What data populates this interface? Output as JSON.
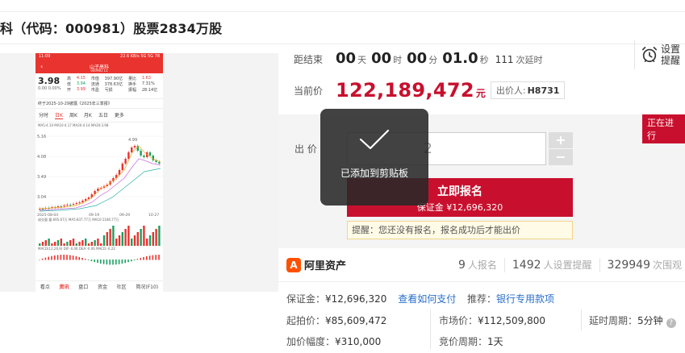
{
  "title": "科（代码：000981）股票2834万股",
  "countdown": {
    "label": "距结束",
    "days": "00",
    "days_unit": "天",
    "hours": "00",
    "hours_unit": "时",
    "minutes": "00",
    "minutes_unit": "分",
    "seconds": "01.0",
    "seconds_unit": "秒",
    "delay_count": "111",
    "delay_label": "次延时"
  },
  "reminder": {
    "line1": "设置",
    "line2": "提醒"
  },
  "price": {
    "label": "当前价",
    "value": "122,189,472",
    "unit": "元",
    "bidder_label": "出价人:",
    "bidder": "H8731"
  },
  "status_badge": "正在进行",
  "bid": {
    "label": "出 价",
    "input_value": "2",
    "plus": "+",
    "minus": "−",
    "signup_label": "立即报名",
    "deposit_line": "保证金 ¥12,696,320",
    "tip": "提醒：您还没有报名，报名成功后才能出价"
  },
  "toast": {
    "text": "已添加到剪贴板"
  },
  "stats": {
    "brand": "阿里资产",
    "signups": "9",
    "signups_label": "人报名",
    "reminders": "1492",
    "reminders_label": "人设置提醒",
    "views": "329949",
    "views_label": "次围观"
  },
  "details": {
    "deposit_label": "保证金：",
    "deposit_value": "¥12,696,320",
    "pay_link": "查看如何支付",
    "recommend_label": "推荐：",
    "recommend_link": "银行专用款项",
    "start_label": "起拍价：",
    "start_value": "¥85,609,472",
    "market_label": "市场价：",
    "market_value": "¥112,509,800",
    "delay_label": "延时周期：",
    "delay_value": "5分钟",
    "increment_label": "加价幅度：",
    "increment_value": "¥310,000",
    "cycle_label": "竞价周期：",
    "cycle_value": "1天"
  },
  "phone": {
    "status_time": "11:09",
    "status_right": "22.6 KB/s 5G 5G 78",
    "title": "山子高科",
    "subtitle": "000981 L1 ",
    "price": "3.98",
    "change": "0.00  0.00%",
    "quote_rows": [
      [
        "高",
        "4.15",
        "市值",
        "397.90亿",
        "量比",
        "1.63"
      ],
      [
        "低",
        "3.94",
        "流通",
        "378.63亿",
        "换手",
        "7.31%"
      ],
      [
        "开",
        "3.99",
        "市盈",
        "亏损",
        "振幅",
        "28.14亿"
      ]
    ],
    "notice": "终于2025-10-29披露《2025年三季报》",
    "tabs": [
      "分时",
      "日K",
      "周K",
      "月K",
      "五日",
      "更多"
    ],
    "active_tab": "日K",
    "legend": "MA5:4.10  MA10:4.17  MA20:4.14  MA30:3.98",
    "price_labels": [
      "5.16",
      "4.99",
      "4.08",
      "3.49",
      "3.04"
    ],
    "date_labels": [
      "2025-08-04",
      "09-19",
      "09-29",
      "10-27"
    ],
    "vol_label": "成交量  量:695.67万  MA5:837.77万  MA10:1180.77万",
    "macd_label": "MACD(12,26,9)  DIF:-0.06  DEA:-0.06  MACD:-0.22",
    "bottom_nav": [
      "看点",
      "资讯",
      "盘口",
      "资金",
      "社区",
      "简况(F10)"
    ],
    "active_nav": "资讯"
  },
  "colors": {
    "brand_red": "#c8102e",
    "phone_red": "#e9332e",
    "link_blue": "#2a6fc9",
    "alibaba_orange": "#ff5000"
  }
}
